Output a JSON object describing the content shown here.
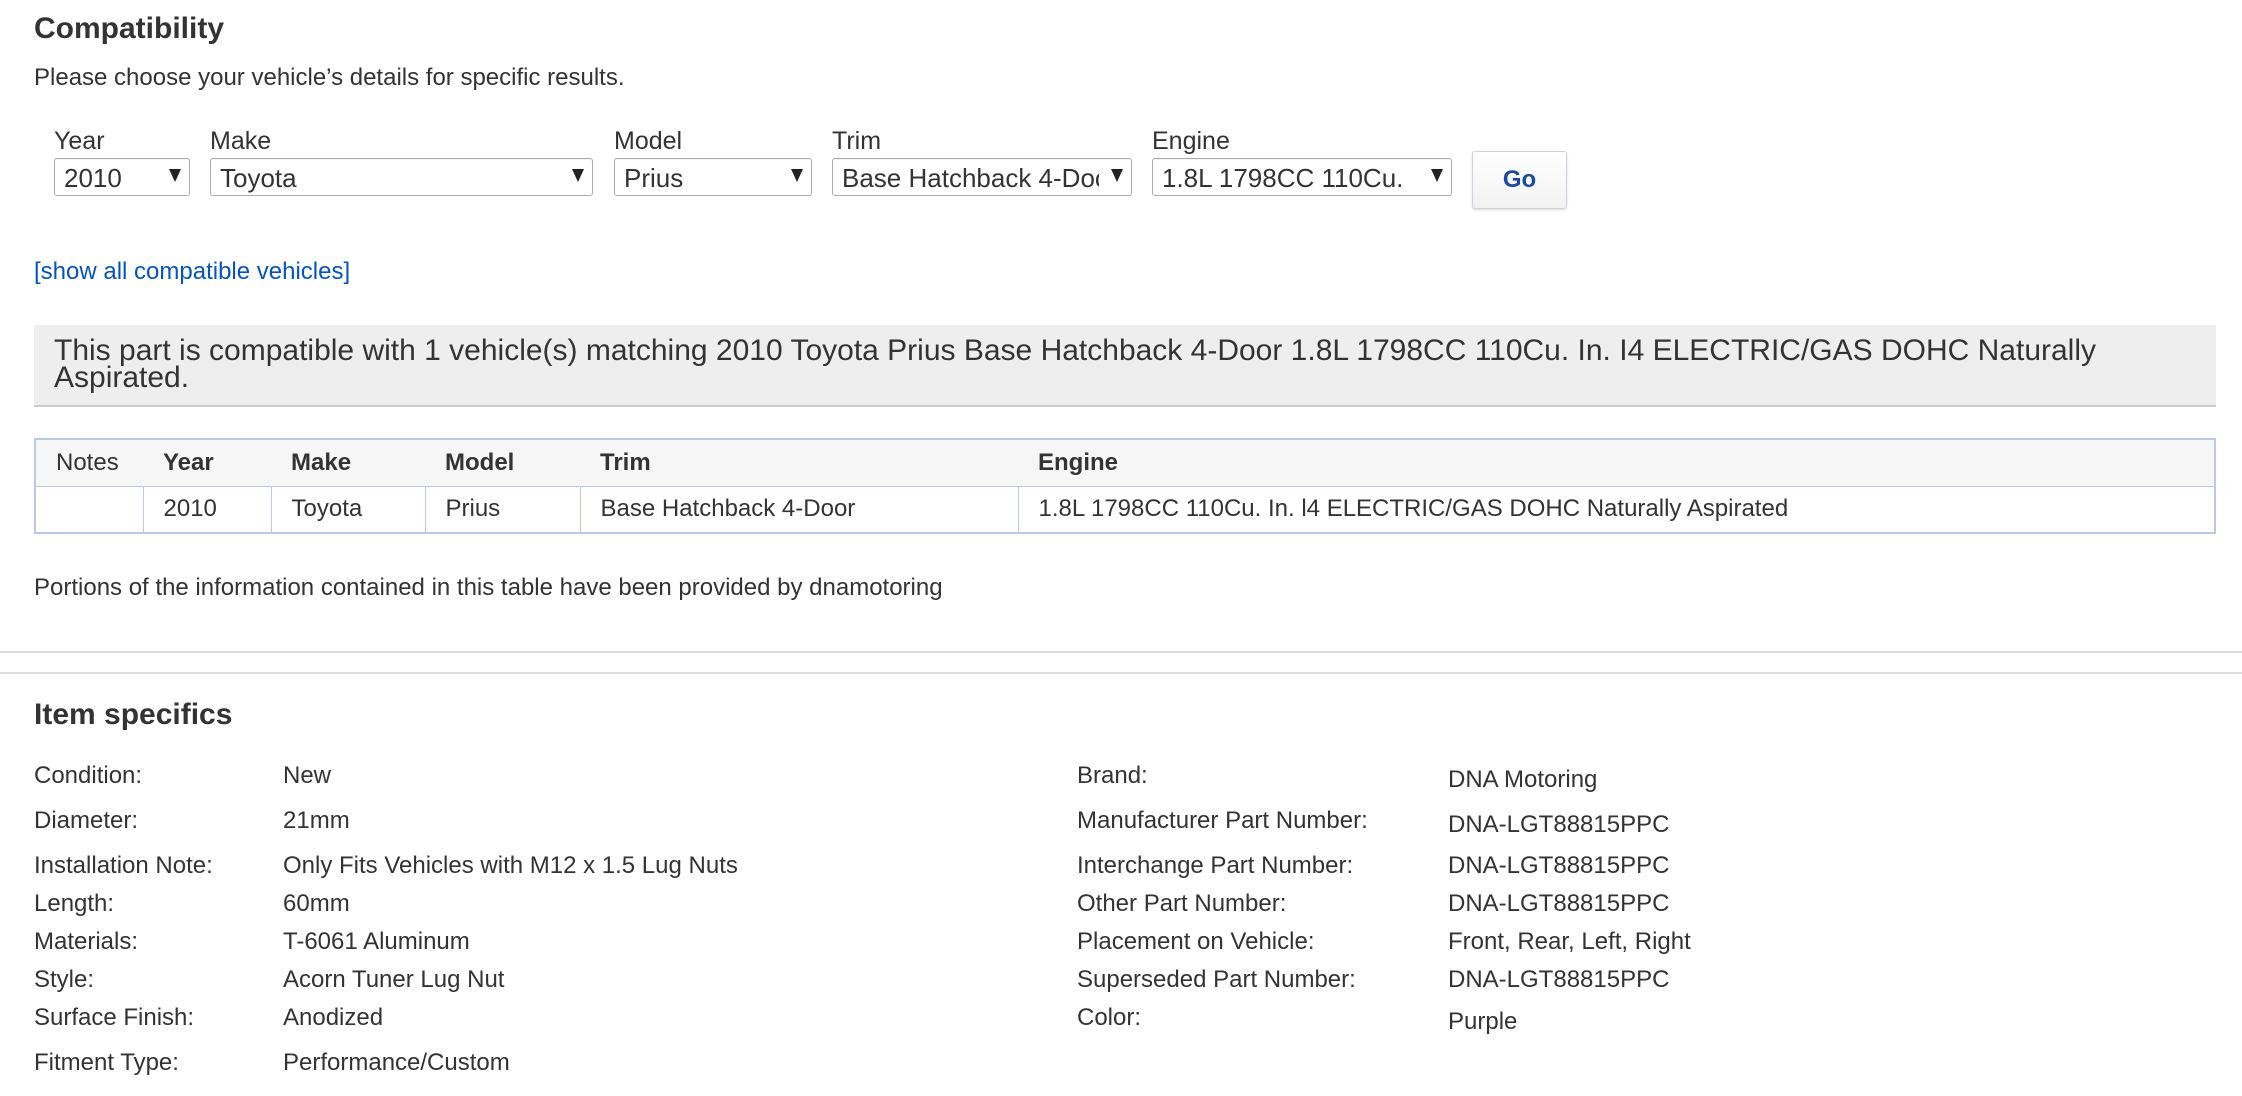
{
  "compatibility": {
    "title": "Compatibility",
    "subtitle": "Please choose your vehicle’s details for specific results.",
    "filters": {
      "year": {
        "label": "Year",
        "value": "2010"
      },
      "make": {
        "label": "Make",
        "value": "Toyota"
      },
      "model": {
        "label": "Model",
        "value": "Prius"
      },
      "trim": {
        "label": "Trim",
        "value": "Base Hatchback 4-Door"
      },
      "engine": {
        "label": "Engine",
        "value": "1.8L 1798CC 110Cu."
      }
    },
    "go_label": "Go",
    "show_all_link": "[show all compatible vehicles]",
    "match_message": "This part is compatible with 1 vehicle(s) matching 2010 Toyota Prius Base Hatchback 4-Door 1.8L 1798CC 110Cu. In. I4 ELECTRIC/GAS DOHC Naturally Aspirated.",
    "table": {
      "headers": {
        "notes": "Notes",
        "year": "Year",
        "make": "Make",
        "model": "Model",
        "trim": "Trim",
        "engine": "Engine"
      },
      "rows": [
        {
          "notes": "",
          "year": "2010",
          "make": "Toyota",
          "model": "Prius",
          "trim": "Base Hatchback 4-Door",
          "engine": "1.8L 1798CC 110Cu. In. l4 ELECTRIC/GAS DOHC Naturally Aspirated"
        }
      ]
    },
    "provided_by": "Portions of the information contained in this table have been provided by dnamotoring"
  },
  "item_specifics": {
    "title": "Item specifics",
    "left": [
      {
        "label": "Condition:",
        "value": "New"
      },
      {
        "label": "Diameter:",
        "value": "21mm"
      },
      {
        "label": "Installation Note:",
        "value": "Only Fits Vehicles with M12 x 1.5 Lug Nuts"
      },
      {
        "label": "Length:",
        "value": "60mm"
      },
      {
        "label": "Materials:",
        "value": "T-6061 Aluminum"
      },
      {
        "label": "Style:",
        "value": "Acorn Tuner Lug Nut"
      },
      {
        "label": "Surface Finish:",
        "value": "Anodized"
      },
      {
        "label": "Fitment Type:",
        "value": "Performance/Custom"
      }
    ],
    "right": [
      {
        "label": "Brand:",
        "value": "DNA Motoring"
      },
      {
        "label": "Manufacturer Part Number:",
        "value": "DNA-LGT88815PPC"
      },
      {
        "label": "Interchange Part Number:",
        "value": "DNA-LGT88815PPC"
      },
      {
        "label": "Other Part Number:",
        "value": "DNA-LGT88815PPC"
      },
      {
        "label": "Placement on Vehicle:",
        "value": "Front, Rear, Left, Right"
      },
      {
        "label": "Superseded Part Number:",
        "value": "DNA-LGT88815PPC"
      },
      {
        "label": "Color:",
        "value": "Purple"
      }
    ]
  },
  "colors": {
    "link": "#0654ba",
    "go_text": "#1c4aa0",
    "table_border": "#b9c9e6",
    "banner_bg": "#eeeeee"
  }
}
